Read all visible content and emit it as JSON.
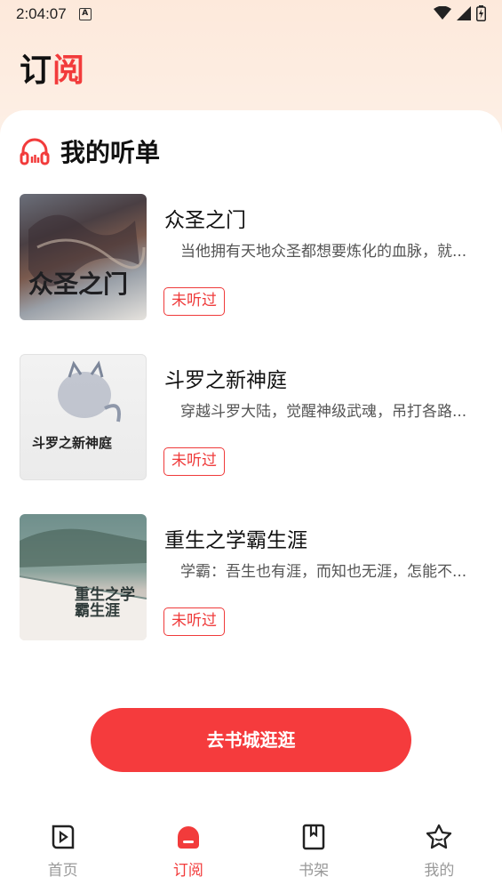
{
  "status_bar": {
    "time": "2:04:07",
    "notification_icon": "A"
  },
  "header": {
    "title_part1": "订",
    "title_part2": "阅"
  },
  "section": {
    "title": "我的听单",
    "icon": "headphones-icon"
  },
  "books": [
    {
      "title": "众圣之门",
      "description": "当他拥有天地众圣都想要炼化的血脉，就...",
      "badge": "未听过",
      "cover_text": "众圣之门"
    },
    {
      "title": "斗罗之新神庭",
      "description": "穿越斗罗大陆，觉醒神级武魂，吊打各路...",
      "badge": "未听过",
      "cover_text": "斗罗之新神庭"
    },
    {
      "title": "重生之学霸生涯",
      "description": "学霸：吾生也有涯，而知也无涯，怎能不...",
      "badge": "未听过",
      "cover_text": "重生之学霸生涯"
    }
  ],
  "cta": {
    "label": "去书城逛逛"
  },
  "tabbar": {
    "items": [
      {
        "label": "首页",
        "icon": "play-book-icon"
      },
      {
        "label": "订阅",
        "icon": "subscribe-icon"
      },
      {
        "label": "书架",
        "icon": "bookshelf-icon"
      },
      {
        "label": "我的",
        "icon": "profile-star-icon"
      }
    ],
    "active": "订阅"
  },
  "colors": {
    "accent": "#f23b3b",
    "cta": "#f53b3d",
    "inactive": "#999999"
  }
}
